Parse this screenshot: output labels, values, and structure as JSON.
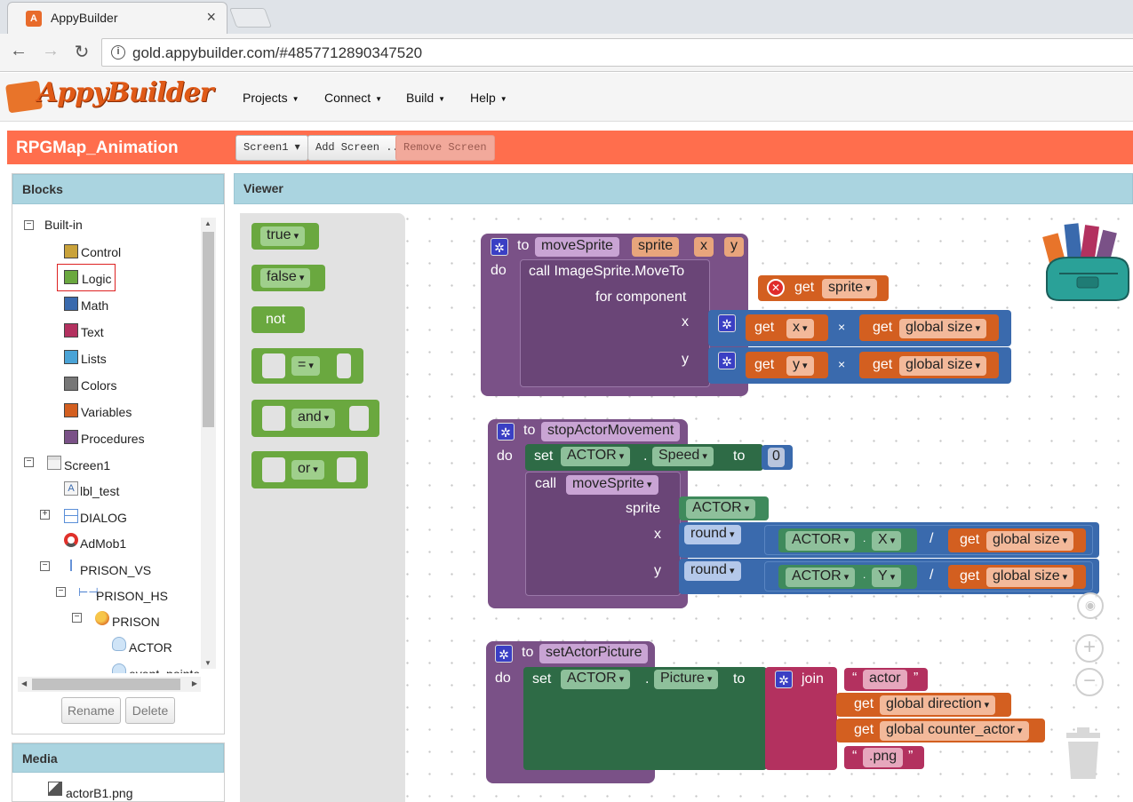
{
  "browser": {
    "tab_title": "AppyBuilder",
    "tab_close": "×",
    "url": "gold.appybuilder.com/#4857712890347520"
  },
  "app": {
    "logo_text": "AppyBuilder",
    "menu": [
      {
        "label": "Projects"
      },
      {
        "label": "Connect"
      },
      {
        "label": "Build"
      },
      {
        "label": "Help"
      }
    ]
  },
  "project": {
    "name": "RPGMap_Animation",
    "screen_button": "Screen1 ▾",
    "add_screen": "Add Screen ...",
    "remove_screen": "Remove Screen"
  },
  "blocks_panel": {
    "title": "Blocks",
    "builtin": "Built-in",
    "builtin_items": [
      {
        "label": "Control",
        "color": "#c9a23a"
      },
      {
        "label": "Logic",
        "color": "#6aa83f"
      },
      {
        "label": "Math",
        "color": "#3a6aad"
      },
      {
        "label": "Text",
        "color": "#b3315f"
      },
      {
        "label": "Lists",
        "color": "#4aa3d6"
      },
      {
        "label": "Colors",
        "color": "#777777"
      },
      {
        "label": "Variables",
        "color": "#d35f20"
      },
      {
        "label": "Procedures",
        "color": "#7a5187"
      }
    ],
    "components": [
      {
        "label": "Screen1"
      },
      {
        "label": "lbl_test"
      },
      {
        "label": "DIALOG"
      },
      {
        "label": "AdMob1"
      },
      {
        "label": "PRISON_VS"
      },
      {
        "label": "PRISON_HS"
      },
      {
        "label": "PRISON"
      },
      {
        "label": "ACTOR"
      },
      {
        "label": "event_pointer"
      }
    ],
    "rename": "Rename",
    "delete": "Delete"
  },
  "media_panel": {
    "title": "Media",
    "items": [
      {
        "label": "actorB1.png"
      }
    ]
  },
  "viewer": {
    "title": "Viewer",
    "flyout": {
      "true": "true",
      "false": "false",
      "not": "not",
      "eq": "=",
      "and": "and",
      "or": "or"
    },
    "moveSprite": {
      "to": "to",
      "name": "moveSprite",
      "params": [
        "sprite",
        "x",
        "y"
      ],
      "do": "do",
      "call": "call ImageSprite.MoveTo",
      "for_component": "for component",
      "get": "get",
      "sprite_var": "sprite",
      "x": "x",
      "y": "y",
      "times": "×",
      "global_size": "global size"
    },
    "stopActorMovement": {
      "to": "to",
      "name": "stopActorMovement",
      "do": "do",
      "set": "set",
      "component": "ACTOR",
      "dot": ".",
      "prop": "Speed",
      "to_kw": "to",
      "value": "0",
      "call": "call",
      "proc": "moveSprite",
      "sprite": "sprite",
      "x": "x",
      "y": "y",
      "round": "round",
      "X": "X",
      "Y": "Y",
      "div": "/",
      "get": "get",
      "global_size": "global size"
    },
    "setActorPicture": {
      "to": "to",
      "name": "setActorPicture",
      "do": "do",
      "set": "set",
      "component": "ACTOR",
      "dot": ".",
      "prop": "Picture",
      "to_kw": "to",
      "join": "join",
      "str_actor": "actor",
      "get": "get",
      "global_direction": "global direction",
      "global_counter": "global counter_actor",
      "str_png": ".png",
      "lq": "“",
      "rq": "”"
    },
    "zoom": {
      "center": "◉",
      "plus": "+",
      "minus": "−"
    }
  }
}
